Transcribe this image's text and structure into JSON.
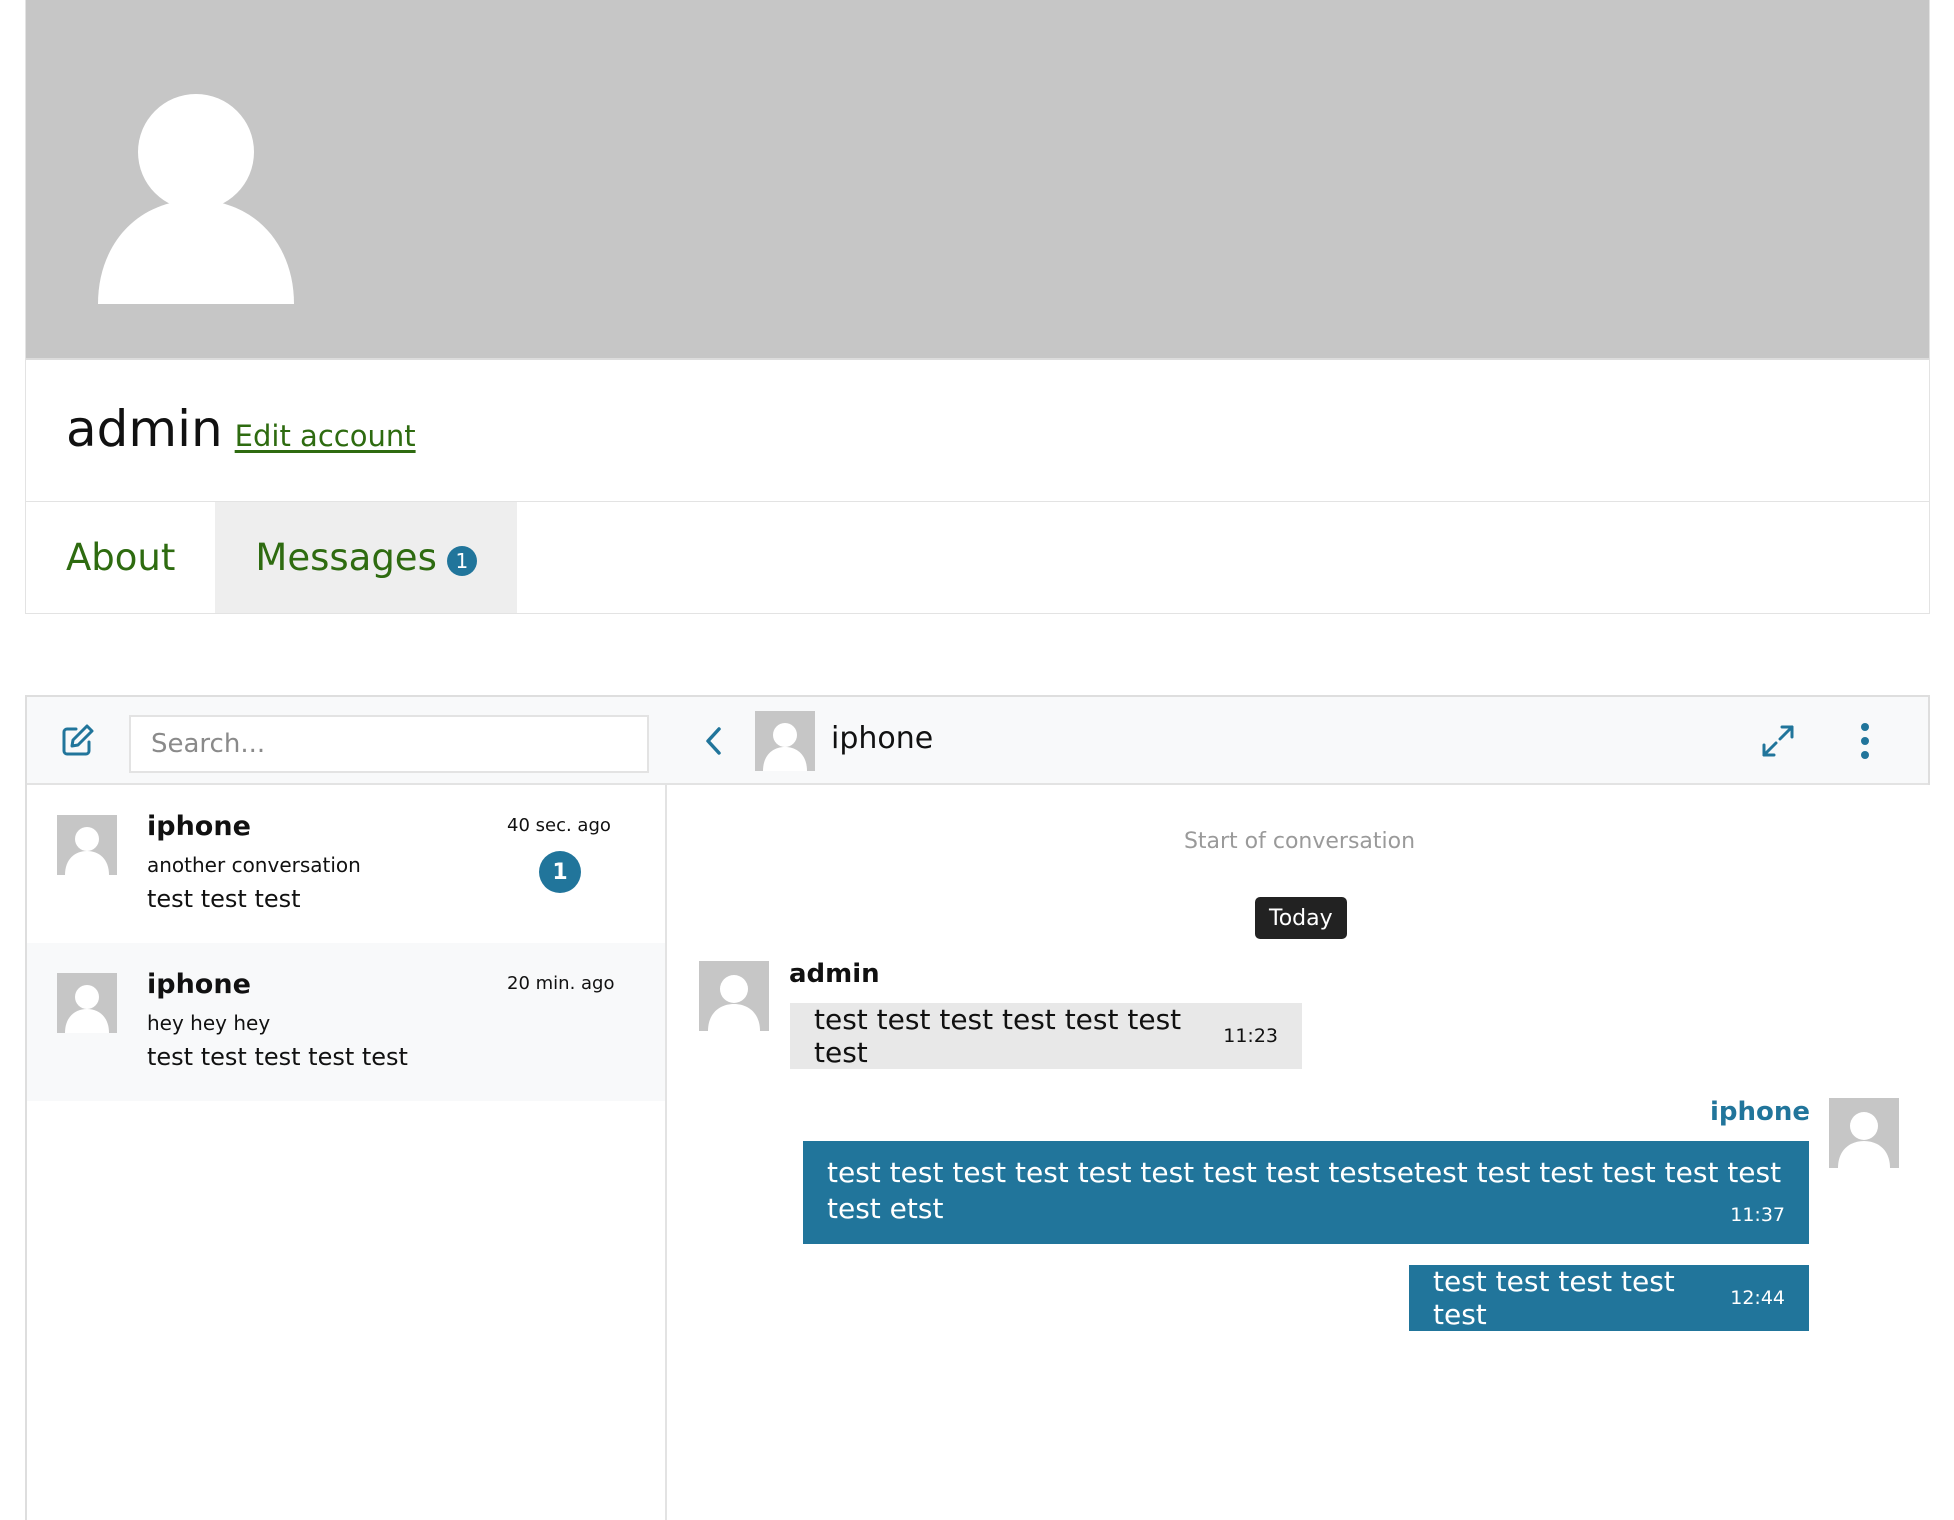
{
  "profile": {
    "username": "admin",
    "edit_link": "Edit account"
  },
  "tabs": [
    {
      "label": "About",
      "active": false
    },
    {
      "label": "Messages",
      "badge": "1",
      "active": true
    }
  ],
  "messenger": {
    "search_placeholder": "Search...",
    "active_conversation": {
      "name": "iphone"
    },
    "conversations": [
      {
        "name": "iphone",
        "subject": "another conversation",
        "preview": "test test test",
        "time": "40 sec. ago",
        "unread": "1"
      },
      {
        "name": "iphone",
        "subject": "hey hey hey",
        "preview": "test test test test test",
        "time": "20 min. ago"
      }
    ],
    "chat": {
      "start_note": "Start of conversation",
      "day_label": "Today",
      "messages": [
        {
          "sender": "admin",
          "text": "test test test test test test test",
          "time": "11:23",
          "direction": "incoming"
        },
        {
          "sender": "iphone",
          "text": "test test test test test test test test testsetest test test test test test test etst",
          "time": "11:37",
          "direction": "outgoing"
        },
        {
          "sender": "iphone",
          "text": "test test test test test",
          "time": "12:44",
          "direction": "outgoing"
        }
      ]
    }
  },
  "colors": {
    "accent": "#21759b",
    "link": "#2e6b10",
    "cover": "#c6c6c6",
    "incoming_bubble": "#e8e8e8"
  },
  "icons": [
    "person-silhouette-icon",
    "compose-icon",
    "chevron-left-icon",
    "expand-icon",
    "kebab-menu-icon"
  ]
}
